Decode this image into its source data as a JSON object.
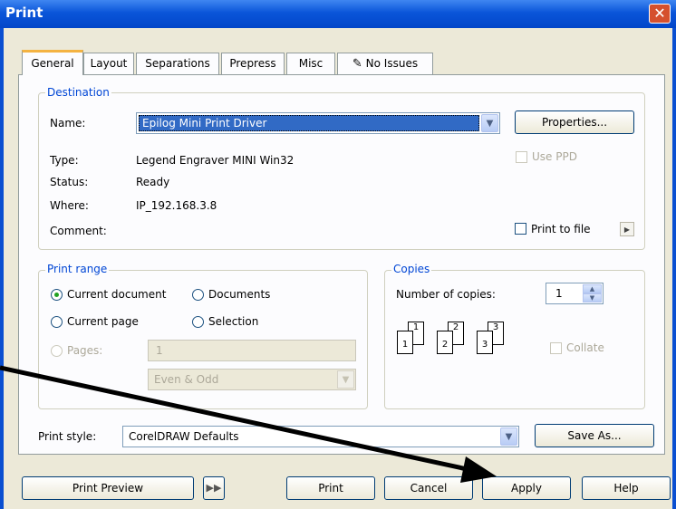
{
  "window": {
    "title": "Print",
    "close_glyph": "✕"
  },
  "tabs": [
    {
      "label": "General"
    },
    {
      "label": "Layout"
    },
    {
      "label": "Separations"
    },
    {
      "label": "Prepress"
    },
    {
      "label": "Misc"
    },
    {
      "label": "No Issues",
      "icon": "issues-icon"
    }
  ],
  "destination": {
    "legend": "Destination",
    "name_label": "Name:",
    "name_value": "Epilog Mini Print Driver",
    "properties_button": "Properties...",
    "type_label": "Type:",
    "type_value": "Legend Engraver MINI Win32",
    "status_label": "Status:",
    "status_value": "Ready",
    "where_label": "Where:",
    "where_value": "IP_192.168.3.8",
    "comment_label": "Comment:",
    "use_ppd_label": "Use PPD",
    "print_to_file_label": "Print to file"
  },
  "print_range": {
    "legend": "Print range",
    "current_document": "Current document",
    "documents": "Documents",
    "current_page": "Current page",
    "selection": "Selection",
    "pages_label": "Pages:",
    "pages_value": "1",
    "even_odd_value": "Even & Odd"
  },
  "copies": {
    "legend": "Copies",
    "number_label": "Number of copies:",
    "number_value": "1",
    "collate_label": "Collate",
    "collate_icons": [
      "1",
      "1",
      "2",
      "2",
      "3",
      "3"
    ]
  },
  "print_style": {
    "label": "Print style:",
    "value": "CorelDRAW Defaults",
    "save_as_button": "Save As..."
  },
  "footer": {
    "print_preview": "Print Preview",
    "print": "Print",
    "cancel": "Cancel",
    "apply": "Apply",
    "help": "Help"
  },
  "colors": {
    "accent": "#0046d5",
    "title_bar": "#0a55d9",
    "face": "#ece9d8",
    "selected_field": "#316ac5"
  }
}
